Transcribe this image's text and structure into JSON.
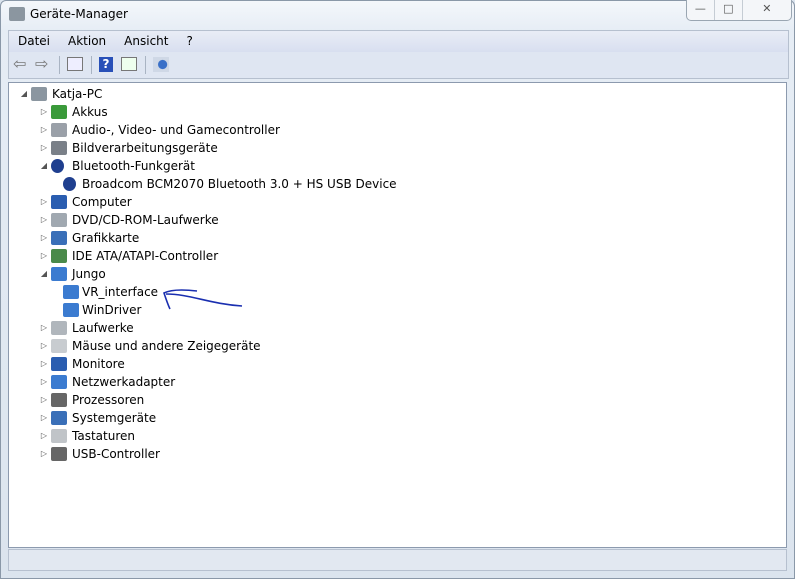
{
  "window": {
    "title": "Geräte-Manager",
    "minimize": "—",
    "maximize": "□",
    "close": "✕"
  },
  "menu": [
    "Datei",
    "Aktion",
    "Ansicht",
    "?"
  ],
  "toolbar": [
    "back-icon",
    "forward-icon",
    "console-tree-icon",
    "help-icon",
    "properties-icon",
    "scan-hardware-icon"
  ],
  "tree": [
    {
      "label": "Katja-PC",
      "level": 0,
      "state": "expanded",
      "icon": "computer-icon"
    },
    {
      "label": "Akkus",
      "level": 1,
      "state": "collapsed",
      "icon": "battery-icon"
    },
    {
      "label": "Audio-, Video- und Gamecontroller",
      "level": 1,
      "state": "collapsed",
      "icon": "speaker-icon"
    },
    {
      "label": "Bildverarbeitungsgeräte",
      "level": 1,
      "state": "collapsed",
      "icon": "camera-icon"
    },
    {
      "label": "Bluetooth-Funkgerät",
      "level": 1,
      "state": "expanded",
      "icon": "bluetooth-icon"
    },
    {
      "label": "Broadcom BCM2070 Bluetooth 3.0 + HS USB Device",
      "level": 2,
      "state": "leaf",
      "icon": "bluetooth-icon"
    },
    {
      "label": "Computer",
      "level": 1,
      "state": "collapsed",
      "icon": "monitor-icon"
    },
    {
      "label": "DVD/CD-ROM-Laufwerke",
      "level": 1,
      "state": "collapsed",
      "icon": "disc-icon"
    },
    {
      "label": "Grafikkarte",
      "level": 1,
      "state": "collapsed",
      "icon": "display-adapter-icon"
    },
    {
      "label": "IDE ATA/ATAPI-Controller",
      "level": 1,
      "state": "collapsed",
      "icon": "controller-icon"
    },
    {
      "label": "Jungo",
      "level": 1,
      "state": "expanded",
      "icon": "network-device-icon"
    },
    {
      "label": "VR_interface",
      "level": 2,
      "state": "leaf",
      "icon": "network-device-icon"
    },
    {
      "label": "WinDriver",
      "level": 2,
      "state": "leaf",
      "icon": "network-device-icon"
    },
    {
      "label": "Laufwerke",
      "level": 1,
      "state": "collapsed",
      "icon": "drive-icon"
    },
    {
      "label": "Mäuse und andere Zeigegeräte",
      "level": 1,
      "state": "collapsed",
      "icon": "mouse-icon"
    },
    {
      "label": "Monitore",
      "level": 1,
      "state": "collapsed",
      "icon": "monitor-icon"
    },
    {
      "label": "Netzwerkadapter",
      "level": 1,
      "state": "collapsed",
      "icon": "network-icon"
    },
    {
      "label": "Prozessoren",
      "level": 1,
      "state": "collapsed",
      "icon": "cpu-icon"
    },
    {
      "label": "Systemgeräte",
      "level": 1,
      "state": "collapsed",
      "icon": "system-icon"
    },
    {
      "label": "Tastaturen",
      "level": 1,
      "state": "collapsed",
      "icon": "keyboard-icon"
    },
    {
      "label": "USB-Controller",
      "level": 1,
      "state": "collapsed",
      "icon": "usb-icon"
    }
  ],
  "colors": {
    "annotation": "#1a2fb0"
  }
}
